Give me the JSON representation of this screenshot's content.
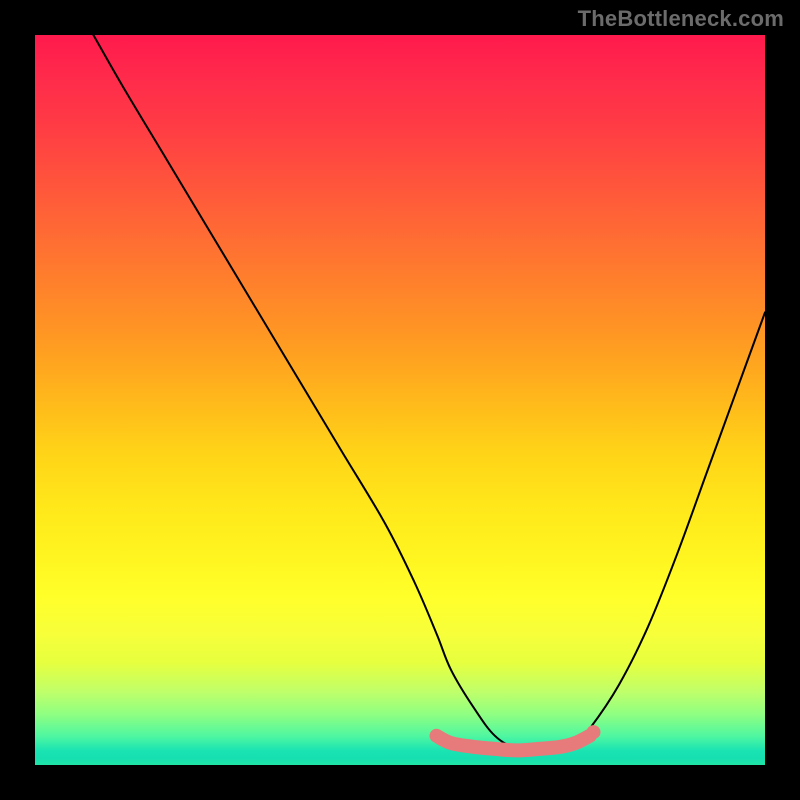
{
  "watermark": "TheBottleneck.com",
  "chart_data": {
    "type": "line",
    "title": "",
    "xlabel": "",
    "ylabel": "",
    "xlim": [
      0,
      100
    ],
    "ylim": [
      0,
      100
    ],
    "grid": false,
    "series": [
      {
        "name": "black-curve",
        "color": "#000000",
        "x": [
          8,
          12,
          18,
          24,
          30,
          36,
          42,
          48,
          52,
          55,
          57,
          60,
          63,
          66,
          69,
          72,
          74,
          76,
          80,
          84,
          88,
          92,
          96,
          100
        ],
        "values": [
          100,
          93,
          83,
          73,
          63,
          53,
          43,
          33,
          25,
          18,
          13,
          8,
          4,
          2.3,
          2,
          2.2,
          3,
          5,
          11,
          19,
          29,
          40,
          51,
          62
        ]
      },
      {
        "name": "pink-band",
        "color": "#e77b7b",
        "x": [
          55,
          57,
          60,
          63,
          66,
          69,
          72,
          74,
          76
        ],
        "values": [
          4,
          3,
          2.5,
          2.2,
          2,
          2.2,
          2.5,
          3,
          4
        ]
      }
    ],
    "markers": [
      {
        "name": "pink-dot-right",
        "x": 76.5,
        "y": 4.5,
        "color": "#e77b7b"
      }
    ]
  }
}
